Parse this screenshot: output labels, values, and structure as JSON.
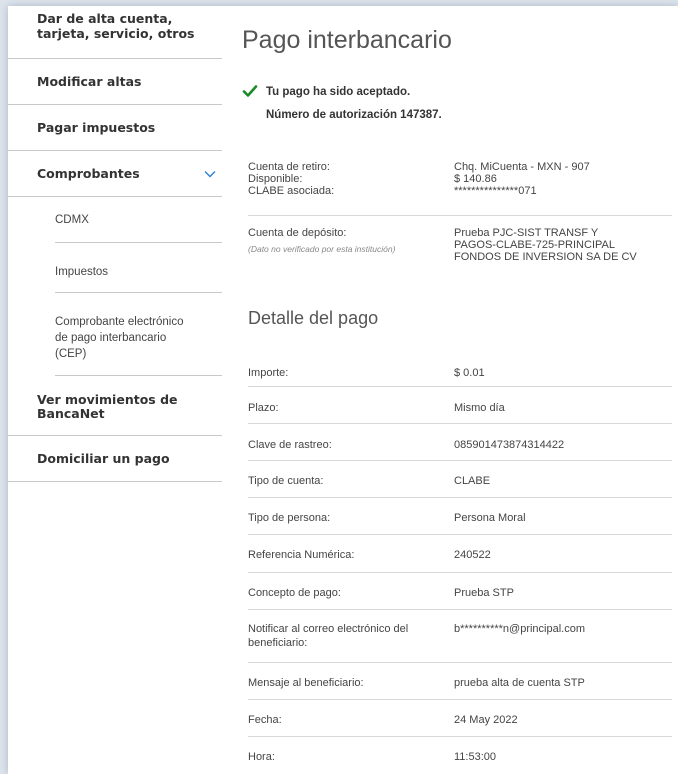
{
  "sidebar": {
    "item1_line1": "Dar de alta cuenta,",
    "item1_line2": "tarjeta, servicio, otros",
    "item2": "Modificar altas",
    "item3": "Pagar impuestos",
    "item4": "Comprobantes",
    "sub1": "CDMX",
    "sub2": "Impuestos",
    "sub3_line1": "Comprobante electrónico",
    "sub3_line2": "de pago interbancario",
    "sub3_line3": "(CEP)",
    "item5_line1": "Ver movimientos de",
    "item5_line2": "BancaNet",
    "item6": "Domiciliar un pago"
  },
  "main": {
    "title": "Pago interbancario",
    "success": "Tu pago ha sido aceptado.",
    "authorization": "Número de autorización 147387.",
    "withdrawal": {
      "label1": "Cuenta de retiro:",
      "label2": "Disponible:",
      "label3": "CLABE asociada:",
      "value1": "Chq. MiCuenta - MXN - 907",
      "value2": "$ 140.86",
      "value3": "***************071"
    },
    "deposit": {
      "label": "Cuenta de depósito:",
      "note": "(Dato no verificado por esta institución)",
      "value1": "Prueba PJC-SIST TRANSF Y",
      "value2": "PAGOS-CLABE-725-PRINCIPAL",
      "value3": "FONDOS DE INVERSION SA DE CV"
    },
    "detail_title": "Detalle del pago",
    "rows": [
      {
        "label": "Importe:",
        "value": "$ 0.01"
      },
      {
        "label": "Plazo:",
        "value": "Mismo día"
      },
      {
        "label": "Clave de rastreo:",
        "value": "085901473874314422"
      },
      {
        "label": "Tipo de cuenta:",
        "value": "CLABE"
      },
      {
        "label": "Tipo de persona:",
        "value": "Persona Moral"
      },
      {
        "label": "Referencia Numérica:",
        "value": "240522"
      },
      {
        "label": "Concepto de pago:",
        "value": "Prueba STP"
      },
      {
        "label": "Notificar al correo electrónico del beneficiario:",
        "value": "b**********n@principal.com"
      },
      {
        "label": "Mensaje al beneficiario:",
        "value": "prueba alta de cuenta STP"
      },
      {
        "label": "Fecha:",
        "value": "24 May 2022"
      },
      {
        "label": "Hora:",
        "value": "11:53:00"
      }
    ]
  },
  "colors": {
    "check_green": "#1a8a2a",
    "chevron_blue": "#2a7fd4",
    "divider": "#c9c9c9"
  },
  "icons": {
    "success": "checkmark-icon",
    "expand": "chevron-down-icon"
  }
}
